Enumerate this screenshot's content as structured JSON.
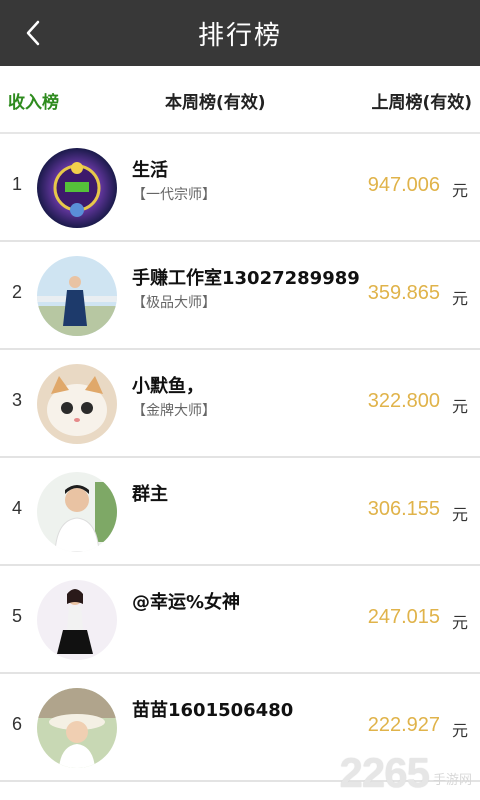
{
  "header": {
    "title": "排行榜",
    "back_icon": "chevron-left-icon"
  },
  "tabs": [
    {
      "label": "收入榜",
      "active": true
    },
    {
      "label": "本周榜(有效)",
      "active": false
    },
    {
      "label": "上周榜(有效)",
      "active": false
    }
  ],
  "rankings": [
    {
      "rank": "1",
      "name": "生活",
      "level": "【一代宗师】",
      "amount": "947.006",
      "unit": "元"
    },
    {
      "rank": "2",
      "name": "手赚工作室13027289989",
      "level": "【极品大师】",
      "amount": "359.865",
      "unit": "元"
    },
    {
      "rank": "3",
      "name": "小默鱼，",
      "level": "【金牌大师】",
      "amount": "322.800",
      "unit": "元"
    },
    {
      "rank": "4",
      "name": "群主",
      "level": "",
      "amount": "306.155",
      "unit": "元"
    },
    {
      "rank": "5",
      "name": "@幸运%女神",
      "level": "",
      "amount": "247.015",
      "unit": "元"
    },
    {
      "rank": "6",
      "name": "苗苗1601506480",
      "level": "",
      "amount": "222.927",
      "unit": "元"
    }
  ],
  "watermark": {
    "number": "2265",
    "text": "手游网"
  },
  "colors": {
    "header_bg": "#383838",
    "active_tab": "#2e8b1e",
    "amount": "#e0b34a"
  }
}
